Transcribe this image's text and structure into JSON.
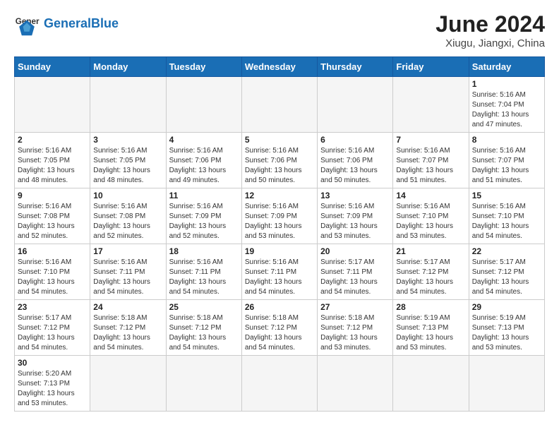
{
  "header": {
    "logo_general": "General",
    "logo_blue": "Blue",
    "month_year": "June 2024",
    "location": "Xiugu, Jiangxi, China"
  },
  "weekdays": [
    "Sunday",
    "Monday",
    "Tuesday",
    "Wednesday",
    "Thursday",
    "Friday",
    "Saturday"
  ],
  "weeks": [
    [
      {
        "day": "",
        "empty": true
      },
      {
        "day": "",
        "empty": true
      },
      {
        "day": "",
        "empty": true
      },
      {
        "day": "",
        "empty": true
      },
      {
        "day": "",
        "empty": true
      },
      {
        "day": "",
        "empty": true
      },
      {
        "day": "1",
        "sunrise": "Sunrise: 5:16 AM",
        "sunset": "Sunset: 7:04 PM",
        "daylight": "Daylight: 13 hours and 47 minutes."
      }
    ],
    [
      {
        "day": "2",
        "sunrise": "Sunrise: 5:16 AM",
        "sunset": "Sunset: 7:05 PM",
        "daylight": "Daylight: 13 hours and 48 minutes."
      },
      {
        "day": "3",
        "sunrise": "Sunrise: 5:16 AM",
        "sunset": "Sunset: 7:05 PM",
        "daylight": "Daylight: 13 hours and 48 minutes."
      },
      {
        "day": "4",
        "sunrise": "Sunrise: 5:16 AM",
        "sunset": "Sunset: 7:06 PM",
        "daylight": "Daylight: 13 hours and 49 minutes."
      },
      {
        "day": "5",
        "sunrise": "Sunrise: 5:16 AM",
        "sunset": "Sunset: 7:06 PM",
        "daylight": "Daylight: 13 hours and 50 minutes."
      },
      {
        "day": "6",
        "sunrise": "Sunrise: 5:16 AM",
        "sunset": "Sunset: 7:06 PM",
        "daylight": "Daylight: 13 hours and 50 minutes."
      },
      {
        "day": "7",
        "sunrise": "Sunrise: 5:16 AM",
        "sunset": "Sunset: 7:07 PM",
        "daylight": "Daylight: 13 hours and 51 minutes."
      },
      {
        "day": "8",
        "sunrise": "Sunrise: 5:16 AM",
        "sunset": "Sunset: 7:07 PM",
        "daylight": "Daylight: 13 hours and 51 minutes."
      }
    ],
    [
      {
        "day": "9",
        "sunrise": "Sunrise: 5:16 AM",
        "sunset": "Sunset: 7:08 PM",
        "daylight": "Daylight: 13 hours and 52 minutes."
      },
      {
        "day": "10",
        "sunrise": "Sunrise: 5:16 AM",
        "sunset": "Sunset: 7:08 PM",
        "daylight": "Daylight: 13 hours and 52 minutes."
      },
      {
        "day": "11",
        "sunrise": "Sunrise: 5:16 AM",
        "sunset": "Sunset: 7:09 PM",
        "daylight": "Daylight: 13 hours and 52 minutes."
      },
      {
        "day": "12",
        "sunrise": "Sunrise: 5:16 AM",
        "sunset": "Sunset: 7:09 PM",
        "daylight": "Daylight: 13 hours and 53 minutes."
      },
      {
        "day": "13",
        "sunrise": "Sunrise: 5:16 AM",
        "sunset": "Sunset: 7:09 PM",
        "daylight": "Daylight: 13 hours and 53 minutes."
      },
      {
        "day": "14",
        "sunrise": "Sunrise: 5:16 AM",
        "sunset": "Sunset: 7:10 PM",
        "daylight": "Daylight: 13 hours and 53 minutes."
      },
      {
        "day": "15",
        "sunrise": "Sunrise: 5:16 AM",
        "sunset": "Sunset: 7:10 PM",
        "daylight": "Daylight: 13 hours and 54 minutes."
      }
    ],
    [
      {
        "day": "16",
        "sunrise": "Sunrise: 5:16 AM",
        "sunset": "Sunset: 7:10 PM",
        "daylight": "Daylight: 13 hours and 54 minutes."
      },
      {
        "day": "17",
        "sunrise": "Sunrise: 5:16 AM",
        "sunset": "Sunset: 7:11 PM",
        "daylight": "Daylight: 13 hours and 54 minutes."
      },
      {
        "day": "18",
        "sunrise": "Sunrise: 5:16 AM",
        "sunset": "Sunset: 7:11 PM",
        "daylight": "Daylight: 13 hours and 54 minutes."
      },
      {
        "day": "19",
        "sunrise": "Sunrise: 5:16 AM",
        "sunset": "Sunset: 7:11 PM",
        "daylight": "Daylight: 13 hours and 54 minutes."
      },
      {
        "day": "20",
        "sunrise": "Sunrise: 5:17 AM",
        "sunset": "Sunset: 7:11 PM",
        "daylight": "Daylight: 13 hours and 54 minutes."
      },
      {
        "day": "21",
        "sunrise": "Sunrise: 5:17 AM",
        "sunset": "Sunset: 7:12 PM",
        "daylight": "Daylight: 13 hours and 54 minutes."
      },
      {
        "day": "22",
        "sunrise": "Sunrise: 5:17 AM",
        "sunset": "Sunset: 7:12 PM",
        "daylight": "Daylight: 13 hours and 54 minutes."
      }
    ],
    [
      {
        "day": "23",
        "sunrise": "Sunrise: 5:17 AM",
        "sunset": "Sunset: 7:12 PM",
        "daylight": "Daylight: 13 hours and 54 minutes."
      },
      {
        "day": "24",
        "sunrise": "Sunrise: 5:18 AM",
        "sunset": "Sunset: 7:12 PM",
        "daylight": "Daylight: 13 hours and 54 minutes."
      },
      {
        "day": "25",
        "sunrise": "Sunrise: 5:18 AM",
        "sunset": "Sunset: 7:12 PM",
        "daylight": "Daylight: 13 hours and 54 minutes."
      },
      {
        "day": "26",
        "sunrise": "Sunrise: 5:18 AM",
        "sunset": "Sunset: 7:12 PM",
        "daylight": "Daylight: 13 hours and 54 minutes."
      },
      {
        "day": "27",
        "sunrise": "Sunrise: 5:18 AM",
        "sunset": "Sunset: 7:12 PM",
        "daylight": "Daylight: 13 hours and 53 minutes."
      },
      {
        "day": "28",
        "sunrise": "Sunrise: 5:19 AM",
        "sunset": "Sunset: 7:13 PM",
        "daylight": "Daylight: 13 hours and 53 minutes."
      },
      {
        "day": "29",
        "sunrise": "Sunrise: 5:19 AM",
        "sunset": "Sunset: 7:13 PM",
        "daylight": "Daylight: 13 hours and 53 minutes."
      }
    ],
    [
      {
        "day": "30",
        "sunrise": "Sunrise: 5:20 AM",
        "sunset": "Sunset: 7:13 PM",
        "daylight": "Daylight: 13 hours and 53 minutes."
      },
      {
        "day": "",
        "empty": true
      },
      {
        "day": "",
        "empty": true
      },
      {
        "day": "",
        "empty": true
      },
      {
        "day": "",
        "empty": true
      },
      {
        "day": "",
        "empty": true
      },
      {
        "day": "",
        "empty": true
      }
    ]
  ]
}
